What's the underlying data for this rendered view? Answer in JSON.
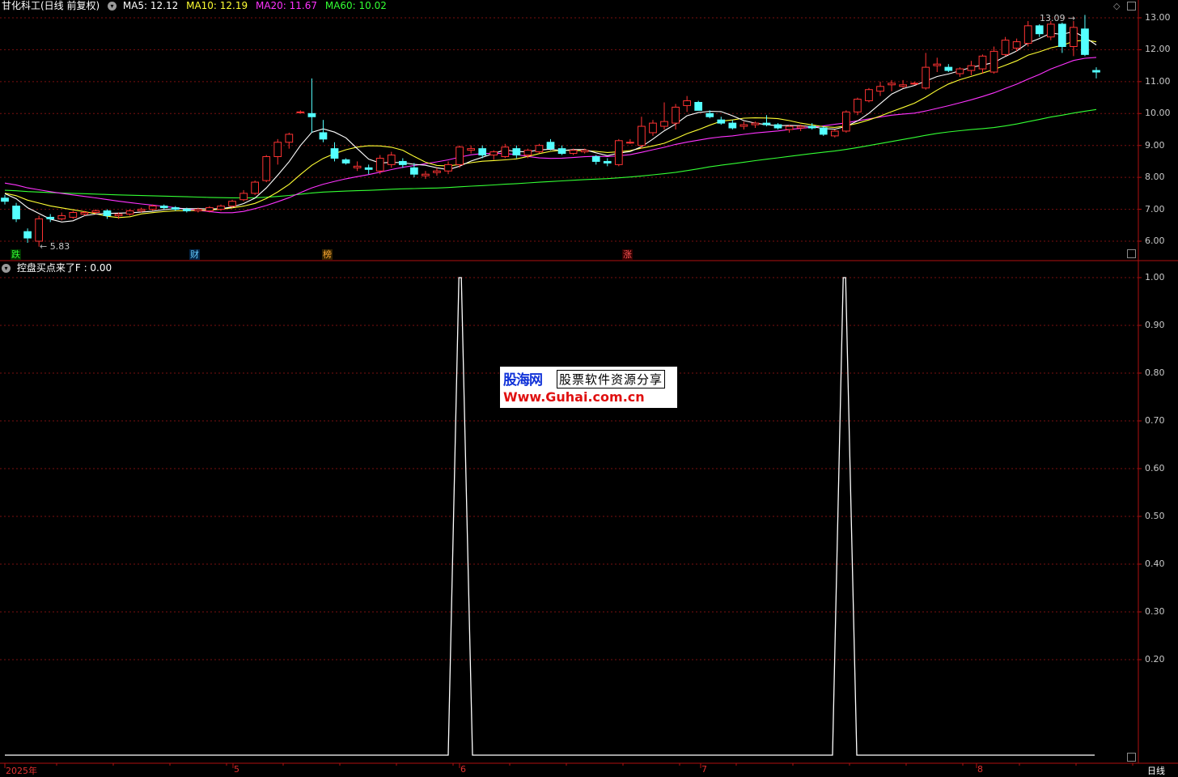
{
  "window": {
    "title": "甘化科工(日线 前复权)",
    "period_button": "日线"
  },
  "ma_legend": [
    {
      "label": "MA5: 12.12",
      "color": "#ffffff"
    },
    {
      "label": "MA10: 12.19",
      "color": "#ffff33"
    },
    {
      "label": "MA20: 11.67",
      "color": "#ff33ff"
    },
    {
      "label": "MA60: 10.02",
      "color": "#33ff33"
    }
  ],
  "price_axis_labels": [
    "13.00",
    "12.00",
    "11.00",
    "10.00",
    "9.00",
    "8.00",
    "7.00",
    "6.00"
  ],
  "price_annotations": {
    "high": "13.09",
    "low": "5.83"
  },
  "event_tags": [
    {
      "label": "跌",
      "color": "#33ff33",
      "bg": "#003300"
    },
    {
      "label": "财",
      "color": "#66ccff",
      "bg": "#002244"
    },
    {
      "label": "榜",
      "color": "#ffaa33",
      "bg": "#332200"
    },
    {
      "label": "涨",
      "color": "#ff5555",
      "bg": "#330000"
    }
  ],
  "indicator": {
    "name": "控盘买点来了F",
    "value_label": ": 0.00",
    "axis_labels": [
      "1.00",
      "0.90",
      "0.80",
      "0.70",
      "0.60",
      "0.50",
      "0.40",
      "0.30",
      "0.20"
    ]
  },
  "time_axis_labels": [
    "2025年",
    "5",
    "6",
    "7",
    "8"
  ],
  "watermark": {
    "brand": "股海网",
    "subtitle": "股票软件资源分享",
    "url": "Www.Guhai.com.cn"
  },
  "colors": {
    "up": "#ff3333",
    "down": "#54ffff",
    "grid": "#7a1010",
    "border": "#b01010",
    "indicator_line": "#ffffff"
  },
  "chart_data": [
    {
      "type": "candlestick",
      "title": "甘化科工(日线 前复权)",
      "ylim": [
        5.6,
        13.3
      ],
      "candles": [
        [
          7.35,
          7.45,
          7.15,
          7.25
        ],
        [
          7.1,
          7.2,
          6.6,
          6.7
        ],
        [
          6.3,
          6.4,
          5.95,
          6.1
        ],
        [
          6.0,
          6.8,
          5.83,
          6.7
        ],
        [
          6.75,
          6.85,
          6.6,
          6.7
        ],
        [
          6.7,
          6.9,
          6.65,
          6.8
        ],
        [
          6.75,
          6.95,
          6.7,
          6.9
        ],
        [
          6.85,
          6.95,
          6.8,
          6.9
        ],
        [
          6.9,
          7.0,
          6.85,
          6.95
        ],
        [
          6.95,
          7.0,
          6.7,
          6.8
        ],
        [
          6.8,
          6.9,
          6.7,
          6.85
        ],
        [
          6.85,
          7.0,
          6.8,
          6.95
        ],
        [
          6.95,
          7.05,
          6.9,
          7.0
        ],
        [
          7.0,
          7.15,
          6.95,
          7.1
        ],
        [
          7.1,
          7.15,
          7.0,
          7.05
        ],
        [
          7.05,
          7.1,
          6.95,
          7.0
        ],
        [
          7.0,
          7.05,
          6.9,
          6.95
        ],
        [
          6.95,
          7.05,
          6.9,
          7.0
        ],
        [
          6.95,
          7.1,
          6.9,
          7.05
        ],
        [
          7.0,
          7.15,
          6.95,
          7.1
        ],
        [
          7.1,
          7.3,
          7.05,
          7.25
        ],
        [
          7.3,
          7.6,
          7.25,
          7.5
        ],
        [
          7.5,
          7.9,
          7.45,
          7.85
        ],
        [
          7.9,
          8.7,
          7.85,
          8.65
        ],
        [
          8.65,
          9.2,
          8.4,
          9.1
        ],
        [
          9.1,
          9.4,
          8.9,
          9.35
        ],
        [
          10.05,
          10.1,
          10.0,
          10.05
        ],
        [
          10.0,
          11.1,
          9.4,
          9.9
        ],
        [
          9.4,
          9.8,
          9.1,
          9.2
        ],
        [
          8.9,
          9.1,
          8.5,
          8.6
        ],
        [
          8.55,
          8.6,
          8.4,
          8.45
        ],
        [
          8.3,
          8.5,
          8.2,
          8.35
        ],
        [
          8.3,
          8.4,
          8.1,
          8.25
        ],
        [
          8.2,
          8.7,
          8.1,
          8.6
        ],
        [
          8.4,
          8.8,
          8.3,
          8.7
        ],
        [
          8.5,
          8.6,
          8.3,
          8.4
        ],
        [
          8.3,
          8.45,
          8.0,
          8.1
        ],
        [
          8.05,
          8.2,
          7.95,
          8.1
        ],
        [
          8.15,
          8.3,
          8.05,
          8.2
        ],
        [
          8.2,
          8.5,
          8.1,
          8.4
        ],
        [
          8.4,
          9.0,
          8.3,
          8.95
        ],
        [
          8.85,
          9.0,
          8.75,
          8.9
        ],
        [
          8.9,
          9.0,
          8.6,
          8.7
        ],
        [
          8.7,
          8.85,
          8.55,
          8.8
        ],
        [
          8.65,
          9.05,
          8.6,
          8.95
        ],
        [
          8.9,
          9.0,
          8.6,
          8.7
        ],
        [
          8.7,
          8.9,
          8.6,
          8.85
        ],
        [
          8.8,
          9.05,
          8.75,
          9.0
        ],
        [
          9.1,
          9.2,
          8.85,
          8.9
        ],
        [
          8.9,
          9.0,
          8.7,
          8.75
        ],
        [
          8.75,
          8.9,
          8.7,
          8.85
        ],
        [
          8.8,
          8.9,
          8.75,
          8.85
        ],
        [
          8.65,
          8.7,
          8.4,
          8.5
        ],
        [
          8.5,
          8.6,
          8.35,
          8.45
        ],
        [
          8.4,
          9.2,
          8.35,
          9.15
        ],
        [
          9.1,
          9.2,
          9.05,
          9.1
        ],
        [
          9.0,
          9.9,
          8.9,
          9.6
        ],
        [
          9.4,
          9.8,
          9.3,
          9.7
        ],
        [
          9.6,
          10.35,
          9.5,
          9.75
        ],
        [
          9.7,
          10.3,
          9.5,
          10.2
        ],
        [
          10.25,
          10.55,
          10.05,
          10.4
        ],
        [
          10.35,
          10.4,
          10.1,
          10.1
        ],
        [
          10.0,
          10.1,
          9.85,
          9.9
        ],
        [
          9.8,
          9.9,
          9.65,
          9.7
        ],
        [
          9.7,
          9.8,
          9.5,
          9.55
        ],
        [
          9.6,
          9.75,
          9.5,
          9.65
        ],
        [
          9.65,
          9.75,
          9.55,
          9.7
        ],
        [
          9.7,
          9.95,
          9.6,
          9.65
        ],
        [
          9.65,
          9.7,
          9.5,
          9.55
        ],
        [
          9.5,
          9.65,
          9.4,
          9.6
        ],
        [
          9.55,
          9.65,
          9.45,
          9.6
        ],
        [
          9.6,
          9.7,
          9.5,
          9.55
        ],
        [
          9.55,
          9.6,
          9.3,
          9.35
        ],
        [
          9.3,
          9.5,
          9.25,
          9.45
        ],
        [
          9.45,
          10.1,
          9.4,
          10.05
        ],
        [
          10.05,
          10.5,
          9.95,
          10.45
        ],
        [
          10.4,
          10.8,
          10.35,
          10.75
        ],
        [
          10.7,
          11.0,
          10.55,
          10.85
        ],
        [
          10.9,
          11.05,
          10.7,
          10.95
        ],
        [
          10.85,
          11.05,
          10.8,
          10.9
        ],
        [
          10.95,
          11.0,
          10.9,
          10.95
        ],
        [
          10.8,
          11.9,
          10.75,
          11.45
        ],
        [
          11.5,
          11.75,
          11.3,
          11.55
        ],
        [
          11.45,
          11.55,
          11.3,
          11.35
        ],
        [
          11.25,
          11.45,
          11.15,
          11.4
        ],
        [
          11.35,
          11.65,
          11.2,
          11.5
        ],
        [
          11.4,
          11.85,
          11.25,
          11.8
        ],
        [
          11.3,
          12.1,
          11.25,
          11.95
        ],
        [
          11.85,
          12.4,
          11.8,
          12.3
        ],
        [
          12.05,
          12.35,
          11.95,
          12.25
        ],
        [
          12.2,
          12.9,
          12.1,
          12.75
        ],
        [
          12.75,
          12.8,
          12.4,
          12.5
        ],
        [
          12.4,
          12.9,
          12.3,
          12.8
        ],
        [
          12.8,
          12.85,
          11.9,
          12.1
        ],
        [
          12.1,
          12.9,
          11.8,
          12.7
        ],
        [
          12.65,
          13.09,
          11.8,
          11.85
        ],
        [
          11.35,
          11.45,
          11.1,
          11.3
        ]
      ]
    },
    {
      "type": "line",
      "title": "控盘买点来了F",
      "ylim": [
        0,
        1.05
      ],
      "series": [
        {
          "name": "控盘买点来了F",
          "values": [
            0,
            0,
            0,
            0,
            0,
            0,
            0,
            0,
            0,
            0,
            0,
            0,
            0,
            0,
            0,
            0,
            0,
            0,
            0,
            0,
            0,
            0,
            0,
            0,
            0,
            0,
            0,
            0,
            0,
            0,
            0,
            0,
            0,
            0,
            0,
            0,
            0,
            0,
            0,
            0,
            1,
            0,
            0,
            0,
            0,
            0,
            0,
            0,
            0,
            0,
            0,
            0,
            0,
            0,
            0,
            0,
            0,
            0,
            0,
            0,
            0,
            0,
            0,
            0,
            0,
            0,
            0,
            0,
            0,
            0,
            0,
            0,
            0,
            0,
            0,
            0,
            0,
            0,
            0,
            0,
            0,
            0,
            0,
            0,
            0,
            0,
            0,
            0,
            0,
            0,
            0,
            0,
            0,
            0,
            0,
            0,
            0
          ]
        }
      ],
      "spikes_at_days": [
        40,
        74
      ]
    }
  ]
}
